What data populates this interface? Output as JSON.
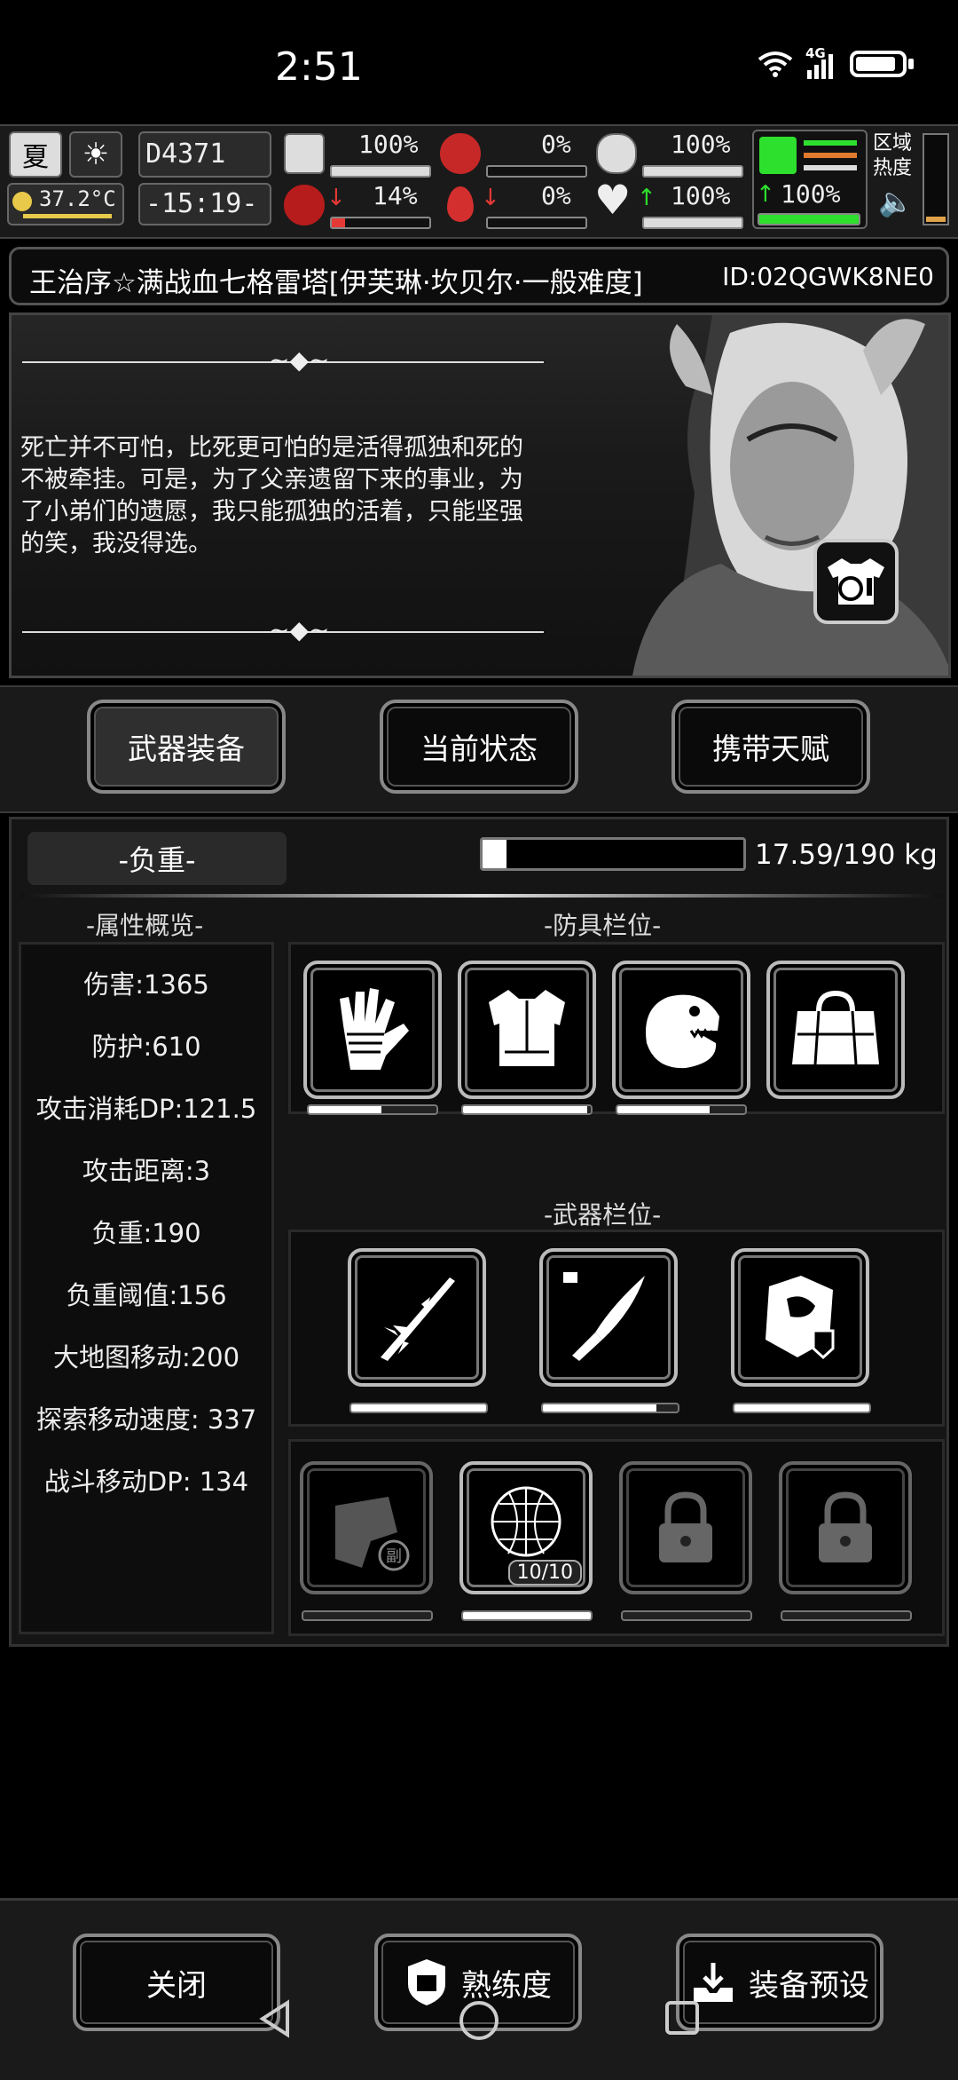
{
  "status_bar": {
    "time": "2:51",
    "network": "4G"
  },
  "hud": {
    "season": "夏",
    "temperature": "37.2°C",
    "day_counter": "D4371",
    "clock": "-15:19-",
    "stats_top": [
      {
        "name": "health",
        "value": "100%",
        "fill": 1.0,
        "icon": "medkit-icon"
      },
      {
        "name": "hunger",
        "value": "0%",
        "fill": 0.0,
        "icon": "stomach-icon"
      },
      {
        "name": "sanity",
        "value": "100%",
        "fill": 1.0,
        "icon": "mask-icon"
      }
    ],
    "stats_bottom": [
      {
        "name": "infection",
        "value": "14%",
        "fill": 0.14,
        "icon": "virus-icon",
        "trend": "down"
      },
      {
        "name": "thirst",
        "value": "0%",
        "fill": 0.0,
        "icon": "blood-drop-icon",
        "trend": "down"
      },
      {
        "name": "mood",
        "value": "100%",
        "fill": 1.0,
        "icon": "heart-icon",
        "trend": "up"
      }
    ],
    "stamina": {
      "value": "100%",
      "fill": 1.0,
      "trend": "up"
    },
    "zone_label": "区域热度"
  },
  "title": {
    "text": "王治序☆满战血七格雷塔[伊芙琳·坎贝尔·一般难度]",
    "id": "ID:02QGWK8NE0"
  },
  "story": {
    "text": "死亡并不可怕，比死更可怕的是活得孤独和死的不被牵挂。可是，为了父亲遗留下来的事业，为了小弟们的遗愿，我只能孤独的活着，只能坚强的笑，我没得选。"
  },
  "tabs": [
    {
      "label": "武器装备",
      "active": true
    },
    {
      "label": "当前状态",
      "active": false
    },
    {
      "label": "携带天赋",
      "active": false
    }
  ],
  "weight": {
    "label": "-负重-",
    "text": "17.59/190 kg",
    "fill": 0.093
  },
  "attributes": {
    "heading": "-属性概览-",
    "items": [
      "伤害:1365",
      "防护:610",
      "攻击消耗DP:121.5",
      "攻击距离:3",
      "负重:190",
      "负重阈值:156",
      "大地图移动:200",
      "探索移动速度: 337",
      "战斗移动DP: 134"
    ]
  },
  "armor": {
    "heading": "-防具栏位-",
    "slots": [
      {
        "icon": "gloves-icon",
        "durability": 0.57
      },
      {
        "icon": "vest-icon",
        "durability": 0.97
      },
      {
        "icon": "dino-mask-icon",
        "durability": 0.72
      },
      {
        "icon": "duffel-bag-icon",
        "durability": null
      }
    ]
  },
  "weapons": {
    "heading": "-武器栏位-",
    "slots": [
      {
        "icon": "spear-icon",
        "durability": 1.0
      },
      {
        "icon": "knife-icon",
        "durability": 0.84
      },
      {
        "icon": "shield-gauntlet-icon",
        "durability": 1.0
      }
    ]
  },
  "extra_slots": [
    {
      "icon": "fist-secondary-icon",
      "badge": "副",
      "locked": false,
      "durability": 0.0
    },
    {
      "icon": "net-trap-icon",
      "count": "10/10",
      "locked": false,
      "durability": 1.0
    },
    {
      "icon": "lock-icon",
      "locked": true,
      "durability": 0.0
    },
    {
      "icon": "lock-icon",
      "locked": true,
      "durability": 0.0
    }
  ],
  "bottom_buttons": [
    {
      "label": "关闭",
      "icon": null
    },
    {
      "label": "熟练度",
      "icon": "badge-icon"
    },
    {
      "label": "装备预设",
      "icon": "download-box-icon"
    }
  ]
}
